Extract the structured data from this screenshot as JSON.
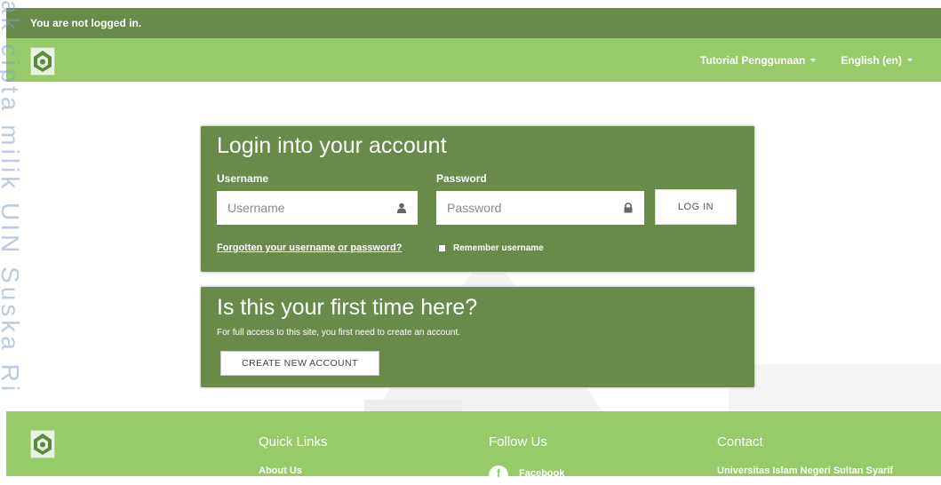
{
  "header": {
    "login_status": "You are not logged in."
  },
  "navbar": {
    "menus": [
      {
        "label": "Tutorial Penggunaan"
      },
      {
        "label": "English (en)"
      }
    ]
  },
  "watermark": {
    "text": "ak cipta milik UIN Suska Ri"
  },
  "login": {
    "title": "Login into your account",
    "username_label": "Username",
    "username_placeholder": "Username",
    "password_label": "Password",
    "password_placeholder": "Password",
    "login_button": "LOG IN",
    "forgot_link": "Forgotten your username or password?",
    "remember_label": "Remember username"
  },
  "signup": {
    "title": "Is this your first time here?",
    "text": "For full access to this site, you first need to create an account.",
    "button": "CREATE NEW ACCOUNT"
  },
  "footer": {
    "quick_links_heading": "Quick Links",
    "quick_links": [
      "About Us"
    ],
    "follow_heading": "Follow Us",
    "follow_links": [
      {
        "label": "Facebook",
        "icon": "facebook-icon"
      }
    ],
    "contact_heading": "Contact",
    "contact_text": "Universitas Islam Negeri Sultan Syarif"
  },
  "colors": {
    "header_dark_green": "#6a8a49",
    "nav_light_green": "#97cb69",
    "panel_green": "#6a8a49"
  }
}
